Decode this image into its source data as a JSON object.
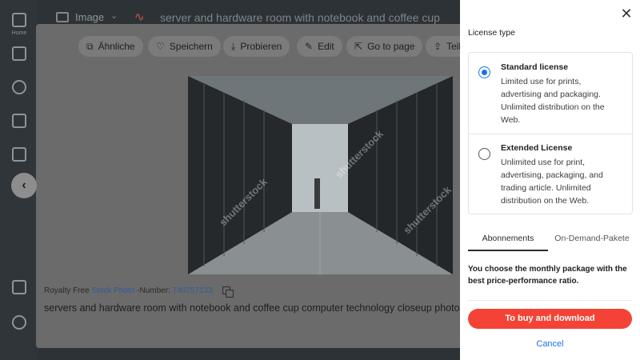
{
  "sidebar": {
    "items": [
      {
        "label": "Home",
        "icon": "home-icon"
      },
      {
        "label": "",
        "icon": "bag-icon"
      },
      {
        "label": "",
        "icon": "brush-icon"
      },
      {
        "label": "",
        "icon": "grid-icon"
      },
      {
        "label": "",
        "icon": "box-icon"
      },
      {
        "label": "",
        "icon": "menu-icon"
      },
      {
        "label": "",
        "icon": "help-icon"
      }
    ]
  },
  "topbar": {
    "type_label": "Image",
    "type_caret": "⌄",
    "search_query": "server and hardware room with notebook and coffee cup"
  },
  "modal": {
    "toolbar": [
      {
        "label": "Ähnliche",
        "icon": "similar-icon",
        "glyph": "⧉"
      },
      {
        "label": "Speichern",
        "icon": "heart-icon",
        "glyph": "♡"
      },
      {
        "label": "Probieren",
        "icon": "download-icon",
        "glyph": "⤓"
      },
      {
        "label": "Edit",
        "icon": "edit-icon",
        "glyph": "✎"
      },
      {
        "label": "Go to page",
        "icon": "external-link-icon",
        "glyph": "⇱"
      },
      {
        "label": "Teil",
        "icon": "share-icon",
        "glyph": "⇪"
      }
    ],
    "watermark": "shutterstock",
    "meta": {
      "prefix": "Royalty Free ",
      "type_link": "Stock Photo",
      "number_label": " -Number: ",
      "number": "740757133"
    },
    "description": "servers and hardware room with notebook and coffee cup computer technology closeup photo",
    "back_glyph": "‹"
  },
  "panel": {
    "close_glyph": "✕",
    "title": "License type",
    "options": [
      {
        "name": "Standard license",
        "description": "Limited use for prints, advertising and packaging. Unlimited distribution on the Web.",
        "selected": true
      },
      {
        "name": "Extended License",
        "description": "Unlimited use for print, advertising, packaging, and trading article. Unlimited distribution on the Web.",
        "selected": false
      }
    ],
    "tabs": [
      {
        "label": "Abonnements",
        "active": true
      },
      {
        "label": "On-Demand-Pakete",
        "active": false
      }
    ],
    "tab_text": "You choose the monthly package with the best price-performance ratio.",
    "buy_label": "To buy and download",
    "cancel_label": "Cancel"
  },
  "colors": {
    "buy_button": "#f44336",
    "radio_selected": "#1a73e8",
    "link": "#1a73e8"
  }
}
